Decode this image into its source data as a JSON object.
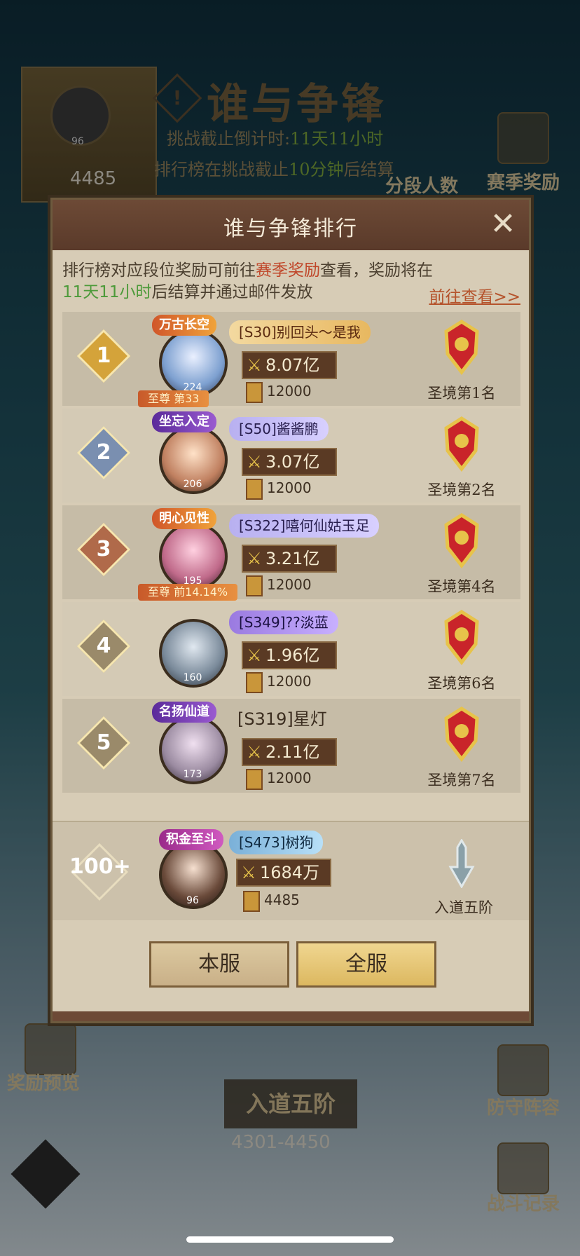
{
  "background": {
    "title": "谁与争锋",
    "countdown_label": "挑战截止倒计时:",
    "countdown_value": "11天11小时",
    "settle_prefix": "排行榜在挑战截止",
    "settle_value": "10分钟",
    "settle_suffix": "后结算",
    "segment_count_label": "分段人数",
    "season_reward_label": "赛季奖励",
    "reward_preview_label": "奖励预览",
    "defense_lineup_label": "防守阵容",
    "battle_record_label": "战斗记录",
    "player_level": "96",
    "player_score": "4485",
    "current_rank_title": "入道五阶",
    "current_rank_range": "4301-4450"
  },
  "dialog": {
    "title": "谁与争锋排行",
    "notice_part1": "排行榜对应段位奖励可前往",
    "notice_highlight": "赛季奖励",
    "notice_part2": "查看，奖励将在",
    "notice_time": "11天11小时",
    "notice_part3": "后结算并通过邮件发放",
    "goto_link": "前往查看>>",
    "rows": [
      {
        "rank": "1",
        "title": "万古长空",
        "name": "[S30]别回头～是我",
        "power": "8.07亿",
        "coins": "12000",
        "level": "224",
        "sub_badge": "至尊 第33",
        "rank_label": "圣境第1名"
      },
      {
        "rank": "2",
        "title": "坐忘入定",
        "name": "[S50]酱酱鹏",
        "power": "3.07亿",
        "coins": "12000",
        "level": "206",
        "sub_badge": "",
        "rank_label": "圣境第2名"
      },
      {
        "rank": "3",
        "title": "明心见性",
        "name": "[S322]嘻何仙姑玉足",
        "power": "3.21亿",
        "coins": "12000",
        "level": "195",
        "sub_badge": "至尊 前14.14%",
        "rank_label": "圣境第4名"
      },
      {
        "rank": "4",
        "title": "",
        "name": "[S349]??淡蓝",
        "power": "1.96亿",
        "coins": "12000",
        "level": "160",
        "sub_badge": "",
        "rank_label": "圣境第6名"
      },
      {
        "rank": "5",
        "title": "名扬仙道",
        "name": "[S319]星灯",
        "power": "2.11亿",
        "coins": "12000",
        "level": "173",
        "sub_badge": "",
        "rank_label": "圣境第7名"
      }
    ],
    "mine": {
      "rank": "100+",
      "title": "积金至斗",
      "name": "[S473]树狗",
      "power": "1684万",
      "coins": "4485",
      "level": "96",
      "rank_label": "入道五阶"
    },
    "btn_local": "本服",
    "btn_all": "全服"
  },
  "colors": {
    "gold": "#e7c34a",
    "red": "#c0472a",
    "green": "#4d9a3a"
  }
}
